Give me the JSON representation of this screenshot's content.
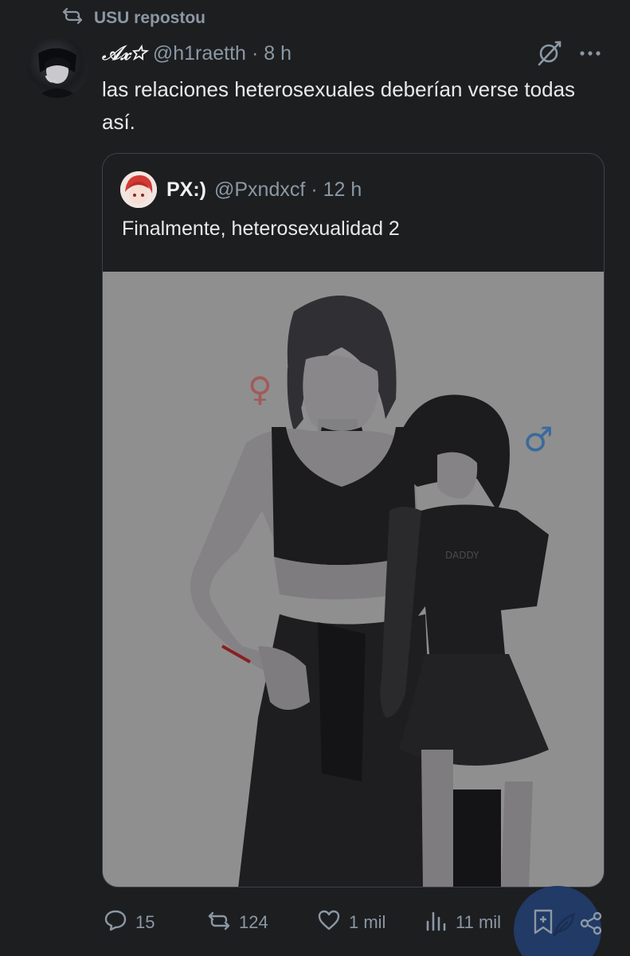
{
  "repost": {
    "label": "USU repostou",
    "icon": "repost-icon"
  },
  "tweet": {
    "author_name": "𝒜𝓍☆",
    "handle": "@h1raetth",
    "separator": "·",
    "time": "8 h",
    "text": "las relaciones heterosexuales deberían verse todas así."
  },
  "quote": {
    "author_name": "PX:)",
    "handle": "@Pxndxcf",
    "separator": "·",
    "time": "12 h",
    "text": "Finalmente, heterosexualidad 2",
    "media": {
      "female_symbol": "♀",
      "male_symbol": "♂",
      "shirt_text": "DADDY"
    }
  },
  "actions": {
    "replies": "15",
    "reposts": "124",
    "likes": "1 mil",
    "views": "11 mil"
  },
  "colors": {
    "background": "#1d1e20",
    "text": "#e7e9ea",
    "muted": "#8b98a5",
    "fab": "#213a66"
  }
}
